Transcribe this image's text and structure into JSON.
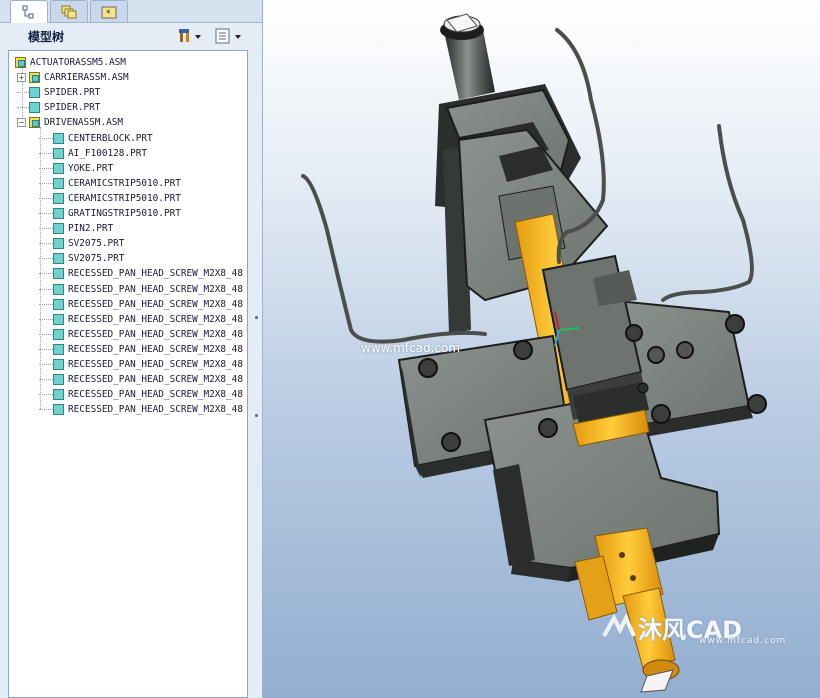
{
  "model_tree": {
    "title": "模型树",
    "items": [
      {
        "label": "ACTUATORASSM5.ASM",
        "type": "asm",
        "level": 0,
        "expander": ""
      },
      {
        "label": "CARRIERASSM.ASM",
        "type": "asm",
        "level": 1,
        "expander": "+"
      },
      {
        "label": "SPIDER.PRT",
        "type": "prt",
        "level": 1,
        "expander": ""
      },
      {
        "label": "SPIDER.PRT",
        "type": "prt",
        "level": 1,
        "expander": ""
      },
      {
        "label": "DRIVENASSM.ASM",
        "type": "asm",
        "level": 1,
        "expander": "−"
      },
      {
        "label": "CENTERBLOCK.PRT",
        "type": "prt",
        "level": 2,
        "expander": ""
      },
      {
        "label": "AI_F100128.PRT",
        "type": "prt",
        "level": 2,
        "expander": ""
      },
      {
        "label": "YOKE.PRT",
        "type": "prt",
        "level": 2,
        "expander": ""
      },
      {
        "label": "CERAMICSTRIP5010.PRT",
        "type": "prt",
        "level": 2,
        "expander": ""
      },
      {
        "label": "CERAMICSTRIP5010.PRT",
        "type": "prt",
        "level": 2,
        "expander": ""
      },
      {
        "label": "GRATINGSTRIP5010.PRT",
        "type": "prt",
        "level": 2,
        "expander": ""
      },
      {
        "label": "PIN2.PRT",
        "type": "prt",
        "level": 2,
        "expander": ""
      },
      {
        "label": "SV2075.PRT",
        "type": "prt",
        "level": 2,
        "expander": ""
      },
      {
        "label": "SV2075.PRT",
        "type": "prt",
        "level": 2,
        "expander": ""
      },
      {
        "label": "RECESSED_PAN_HEAD_SCREW_M2X8_48",
        "type": "prt",
        "level": 2,
        "expander": ""
      },
      {
        "label": "RECESSED_PAN_HEAD_SCREW_M2X8_48",
        "type": "prt",
        "level": 2,
        "expander": ""
      },
      {
        "label": "RECESSED_PAN_HEAD_SCREW_M2X8_48",
        "type": "prt",
        "level": 2,
        "expander": ""
      },
      {
        "label": "RECESSED_PAN_HEAD_SCREW_M2X8_48",
        "type": "prt",
        "level": 2,
        "expander": ""
      },
      {
        "label": "RECESSED_PAN_HEAD_SCREW_M2X8_48",
        "type": "prt",
        "level": 2,
        "expander": ""
      },
      {
        "label": "RECESSED_PAN_HEAD_SCREW_M2X8_48",
        "type": "prt",
        "level": 2,
        "expander": ""
      },
      {
        "label": "RECESSED_PAN_HEAD_SCREW_M2X8_48",
        "type": "prt",
        "level": 2,
        "expander": ""
      },
      {
        "label": "RECESSED_PAN_HEAD_SCREW_M2X8_48",
        "type": "prt",
        "level": 2,
        "expander": ""
      },
      {
        "label": "RECESSED_PAN_HEAD_SCREW_M2X8_48",
        "type": "prt",
        "level": 2,
        "expander": ""
      },
      {
        "label": "RECESSED_PAN_HEAD_SCREW_M2X8_48",
        "type": "prt",
        "level": 2,
        "expander": ""
      }
    ]
  },
  "tabs": [
    {
      "icon": "model-tree-icon"
    },
    {
      "icon": "layers-icon"
    },
    {
      "icon": "favorites-icon"
    }
  ],
  "toolbar_icons": [
    "settings-icon",
    "show-icon"
  ],
  "watermark": {
    "url_text": "www.mfcad.com",
    "logo_text": "沐风CAD",
    "logo_url": "www.mfcad.com"
  },
  "colors": {
    "part_gray": "#7f8580",
    "part_dark": "#1d1f1e",
    "brass": "#f2b01c",
    "background_top": "#ffffff",
    "background_bottom": "#93aed0"
  }
}
